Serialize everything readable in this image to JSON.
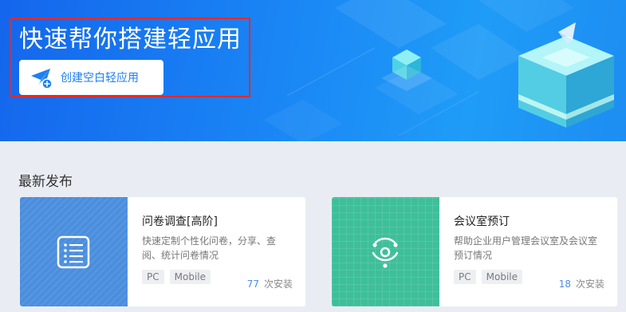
{
  "hero": {
    "title": "快速帮你搭建轻应用",
    "create_button_label": "创建空白轻应用"
  },
  "section": {
    "title": "最新发布"
  },
  "apps": [
    {
      "name": "问卷调查[高阶]",
      "description": "快速定制个性化问卷，分享、查阅、统计问卷情况",
      "tags": [
        "PC",
        "Mobile"
      ],
      "install_count": "77",
      "install_unit": "次安装",
      "icon": "survey-list-icon",
      "color": "#4b8ede"
    },
    {
      "name": "会议室预订",
      "description": "帮助企业用户管理会议室及会议室预订情况",
      "tags": [
        "PC",
        "Mobile"
      ],
      "install_count": "18",
      "install_unit": "次安装",
      "icon": "meeting-room-icon",
      "color": "#3ebf9a"
    }
  ],
  "colors": {
    "accent": "#1d7ff0",
    "highlight": "#e32b2f"
  }
}
